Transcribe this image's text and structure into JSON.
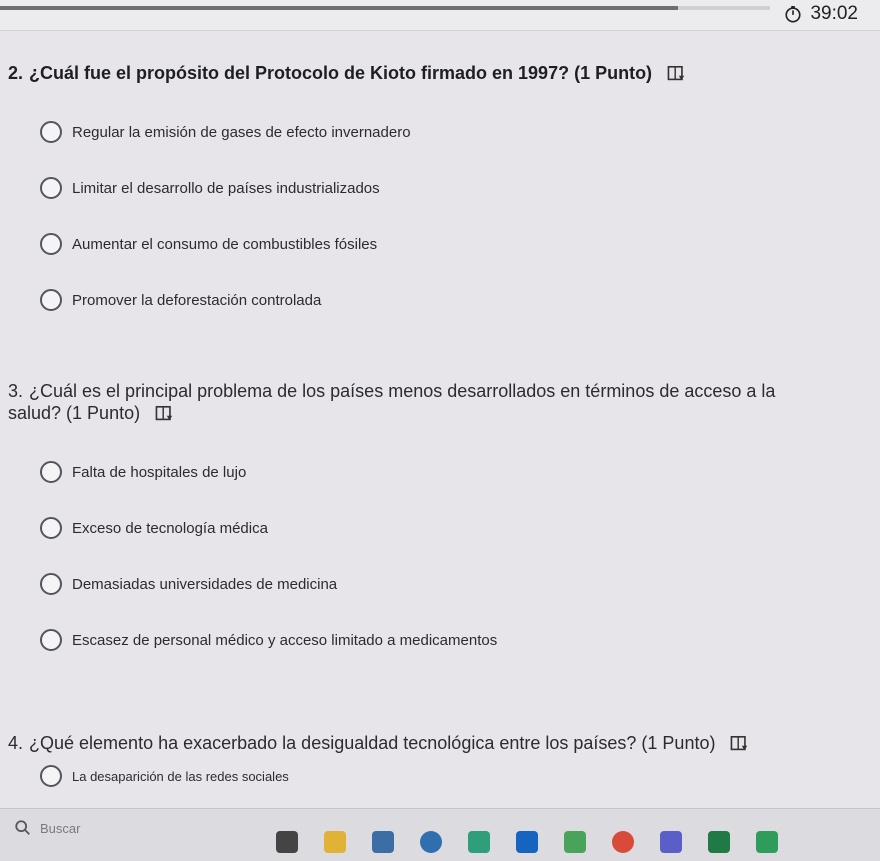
{
  "timer": {
    "text": "39:02"
  },
  "progress": {
    "fraction": 0.88
  },
  "questions": [
    {
      "number": "2.",
      "text": "¿Cuál fue el propósito del Protocolo de Kioto firmado en 1997? (1 Punto)",
      "options": [
        "Regular la emisión de gases de efecto invernadero",
        "Limitar el desarrollo de países industrializados",
        "Aumentar el consumo de combustibles fósiles",
        "Promover la deforestación controlada"
      ]
    },
    {
      "number": "3.",
      "text": "¿Cuál es el principal problema de los países menos desarrollados en términos de acceso a la salud? (1 Punto)",
      "options": [
        "Falta de hospitales de lujo",
        "Exceso de tecnología médica",
        "Demasiadas universidades de medicina",
        "Escasez de personal médico y acceso limitado a medicamentos"
      ]
    },
    {
      "number": "4.",
      "text": "¿Qué elemento ha exacerbado la desigualdad tecnológica entre los países? (1 Punto)",
      "options": [
        "La desaparición de las redes sociales"
      ]
    }
  ],
  "taskbar": {
    "search_placeholder": "Buscar",
    "apps": [
      {
        "icon": "app-icon-1",
        "color": "#444444"
      },
      {
        "icon": "folder-icon",
        "color": "#e0b336"
      },
      {
        "icon": "store-icon",
        "color": "#3a6ea5"
      },
      {
        "icon": "app-icon-blue",
        "color": "#2f6fb0"
      },
      {
        "icon": "edge-icon",
        "color": "#2f9e7a"
      },
      {
        "icon": "outlook-icon",
        "color": "#1565c0"
      },
      {
        "icon": "badge-app-icon",
        "color": "#4aa35a"
      },
      {
        "icon": "chrome-icon",
        "color": "#d84a3a"
      },
      {
        "icon": "teams-icon",
        "color": "#5a5fc7"
      },
      {
        "icon": "excel-icon",
        "color": "#1f7a45"
      },
      {
        "icon": "phone-icon",
        "color": "#2e9d5c"
      }
    ]
  }
}
